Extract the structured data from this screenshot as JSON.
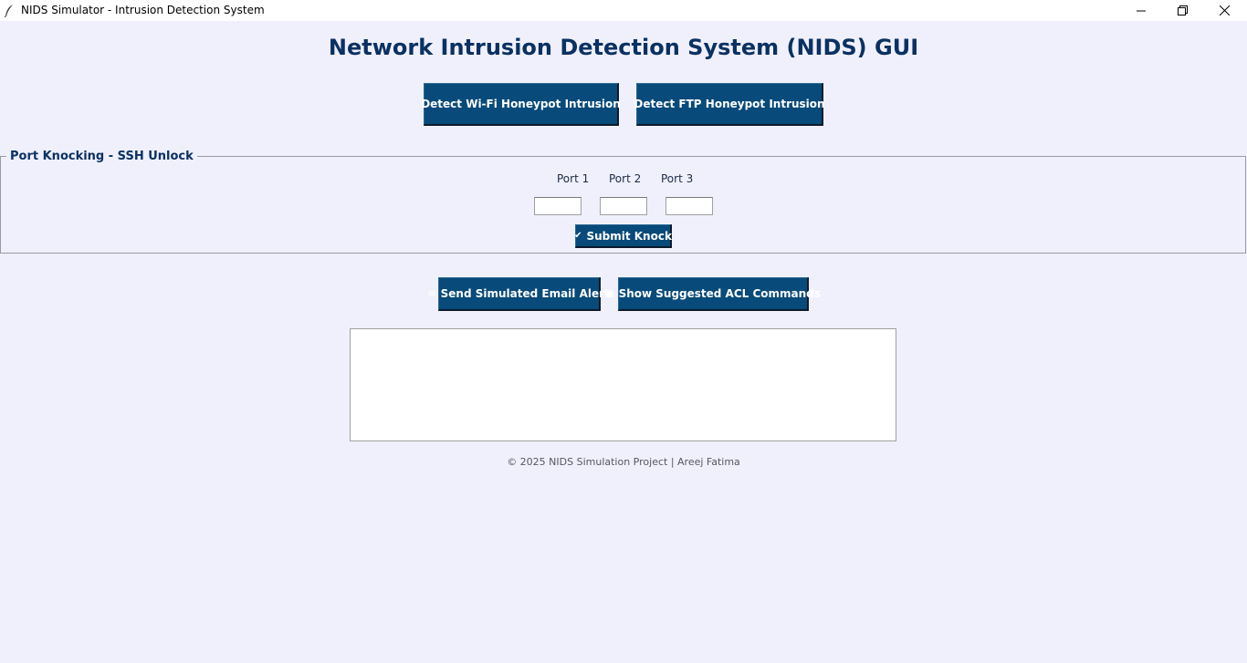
{
  "window": {
    "title": "NIDS Simulator - Intrusion Detection System",
    "icons": [
      "feather-icon",
      "minimize-icon",
      "restore-icon",
      "close-icon"
    ]
  },
  "heading": "Network Intrusion Detection System (NIDS) GUI",
  "detect_buttons": {
    "wifi": "Detect Wi-Fi Honeypot Intrusion",
    "ftp": "Detect FTP Honeypot Intrusion"
  },
  "port_knocking": {
    "title": "Port Knocking - SSH Unlock",
    "port1_label": "Port 1",
    "port2_label": "Port 2",
    "port3_label": "Port 3",
    "port1_value": "",
    "port2_value": "",
    "port3_value": "",
    "submit_icon": "✔",
    "submit_label": "Submit Knock"
  },
  "actions": {
    "email_icon": "✉",
    "email_label": "Send Simulated Email Alert",
    "acl_icon": "▣",
    "acl_label": "Show Suggested ACL Commands"
  },
  "output": {
    "text": ""
  },
  "footer": "© 2025 NIDS Simulation Project | Areej Fatima",
  "colors": {
    "background": "#f0f0fd",
    "button": "#084a7a",
    "heading": "#0a3162"
  }
}
